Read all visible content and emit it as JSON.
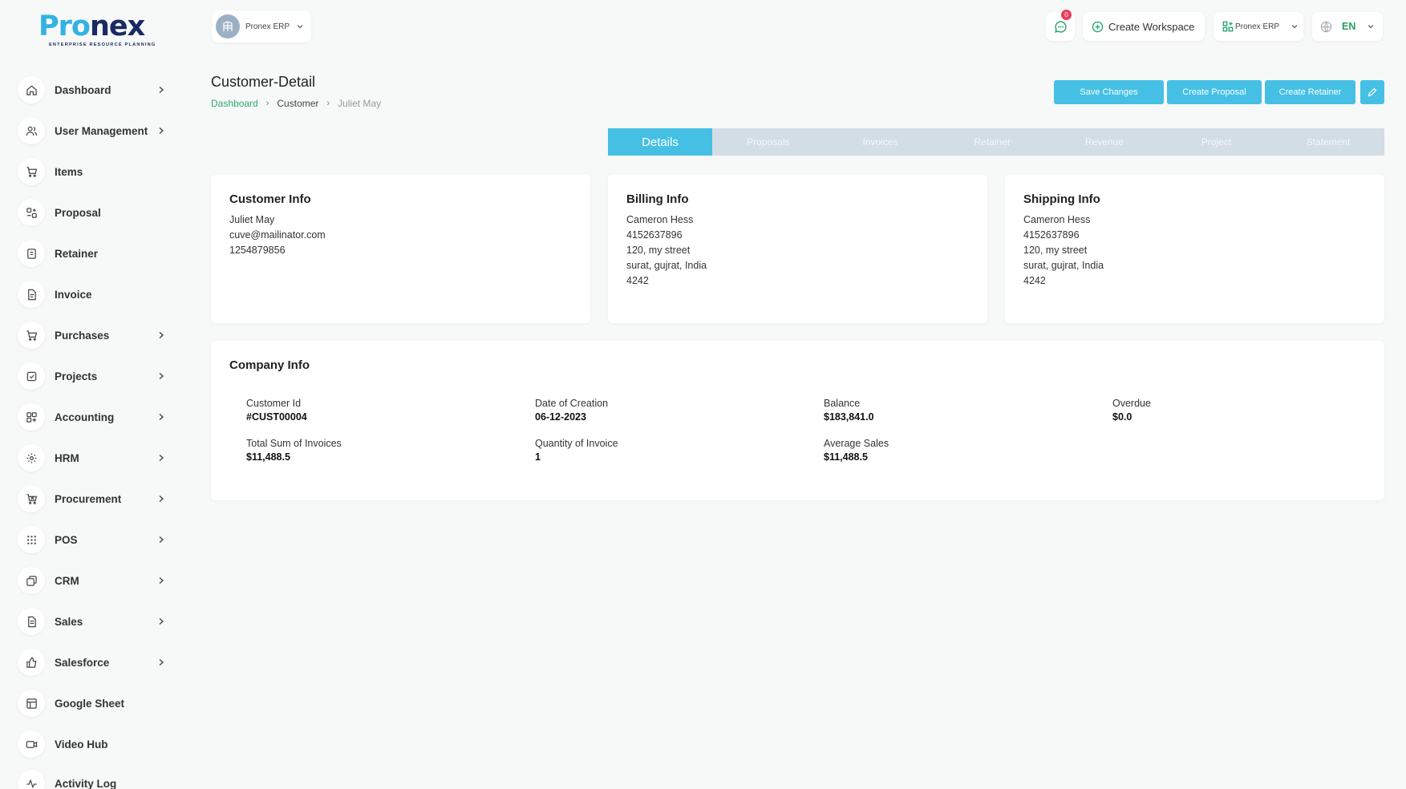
{
  "brand": {
    "logo_word_1": "Pro",
    "logo_word_2": "nex",
    "tagline": "ENTERPRISE RESOURCE PLANNING"
  },
  "sidebar": {
    "items": [
      {
        "label": "Dashboard",
        "icon": "home-icon",
        "has_chevron": true
      },
      {
        "label": "User Management",
        "icon": "users-icon",
        "has_chevron": true
      },
      {
        "label": "Items",
        "icon": "cart-icon",
        "has_chevron": false
      },
      {
        "label": "Proposal",
        "icon": "proposal-icon",
        "has_chevron": false
      },
      {
        "label": "Retainer",
        "icon": "retainer-icon",
        "has_chevron": false
      },
      {
        "label": "Invoice",
        "icon": "invoice-icon",
        "has_chevron": false
      },
      {
        "label": "Purchases",
        "icon": "cart-icon",
        "has_chevron": true
      },
      {
        "label": "Projects",
        "icon": "check-square-icon",
        "has_chevron": true
      },
      {
        "label": "Accounting",
        "icon": "grid-plus-icon",
        "has_chevron": true
      },
      {
        "label": "HRM",
        "icon": "hrm-icon",
        "has_chevron": true
      },
      {
        "label": "Procurement",
        "icon": "procurement-icon",
        "has_chevron": true
      },
      {
        "label": "POS",
        "icon": "dots-grid-icon",
        "has_chevron": true
      },
      {
        "label": "CRM",
        "icon": "crm-icon",
        "has_chevron": true
      },
      {
        "label": "Sales",
        "icon": "file-icon",
        "has_chevron": true
      },
      {
        "label": "Salesforce",
        "icon": "thumbs-up-icon",
        "has_chevron": true
      },
      {
        "label": "Google Sheet",
        "icon": "table-icon",
        "has_chevron": false
      },
      {
        "label": "Video Hub",
        "icon": "video-icon",
        "has_chevron": false
      },
      {
        "label": "Activity Log",
        "icon": "activity-icon",
        "has_chevron": false
      }
    ]
  },
  "topbar": {
    "workspace": "Pronex ERP",
    "message_count": "0",
    "create_workspace": "Create Workspace",
    "erp_label": "Pronex ERP",
    "language": "EN"
  },
  "header": {
    "title": "Customer-Detail",
    "breadcrumb": [
      "Dashboard",
      "Customer",
      "Juliet May"
    ],
    "buttons": {
      "save": "Save Changes",
      "proposal": "Create Proposal",
      "retainer": "Create Retainer"
    }
  },
  "tabs": [
    "Details",
    "Proposals",
    "Invoices",
    "Retainer",
    "Revenue",
    "Project",
    "Statement"
  ],
  "customer_info": {
    "title": "Customer Info",
    "name": "Juliet May",
    "email": "cuve@mailinator.com",
    "phone": "1254879856"
  },
  "billing_info": {
    "title": "Billing Info",
    "name": "Cameron Hess",
    "phone": "4152637896",
    "street": "120, my street",
    "city": "surat, gujrat, India",
    "zip": "4242"
  },
  "shipping_info": {
    "title": "Shipping Info",
    "name": "Cameron Hess",
    "phone": "4152637896",
    "street": "120, my street",
    "city": "surat, gujrat, India",
    "zip": "4242"
  },
  "company_info": {
    "title": "Company Info",
    "stats": [
      {
        "label": "Customer Id",
        "value": "#CUST00004"
      },
      {
        "label": "Date of Creation",
        "value": "06-12-2023"
      },
      {
        "label": "Balance",
        "value": "$183,841.0"
      },
      {
        "label": "Overdue",
        "value": "$0.0"
      },
      {
        "label": "Total Sum of Invoices",
        "value": "$11,488.5"
      },
      {
        "label": "Quantity of Invoice",
        "value": "1"
      },
      {
        "label": "Average Sales",
        "value": "$11,488.5"
      }
    ]
  },
  "colors": {
    "accent": "#45c0e4",
    "green": "#2aa870",
    "tab_bg": "#d2dde6"
  }
}
